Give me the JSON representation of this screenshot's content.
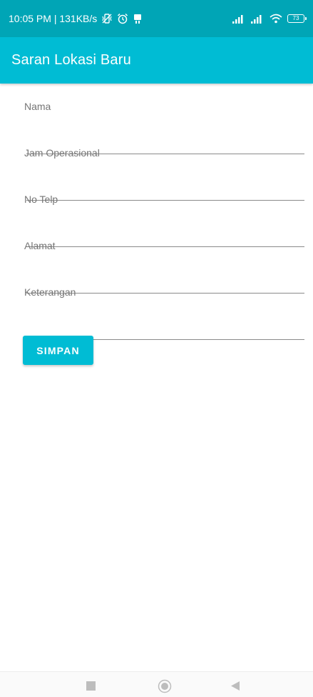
{
  "status_bar": {
    "time_speed": "10:05 PM | 131KB/s",
    "battery_level": "73",
    "left_icons": [
      "no-vibrate-icon",
      "alarm-icon",
      "device-icon"
    ],
    "right_icons": [
      "signal-icon",
      "signal-icon",
      "wifi-icon",
      "battery-icon"
    ]
  },
  "app_bar": {
    "title": "Saran Lokasi Baru",
    "color": "#00bcd4"
  },
  "form": {
    "fields": [
      {
        "label": "Nama",
        "value": ""
      },
      {
        "label": "Jam Operasional",
        "value": ""
      },
      {
        "label": "No Telp",
        "value": ""
      },
      {
        "label": "Alamat",
        "value": ""
      },
      {
        "label": "Keterangan",
        "value": ""
      }
    ],
    "save_label": "SIMPAN"
  },
  "nav_bar": {
    "icons": [
      "recent-apps-icon",
      "home-icon",
      "back-icon"
    ]
  }
}
